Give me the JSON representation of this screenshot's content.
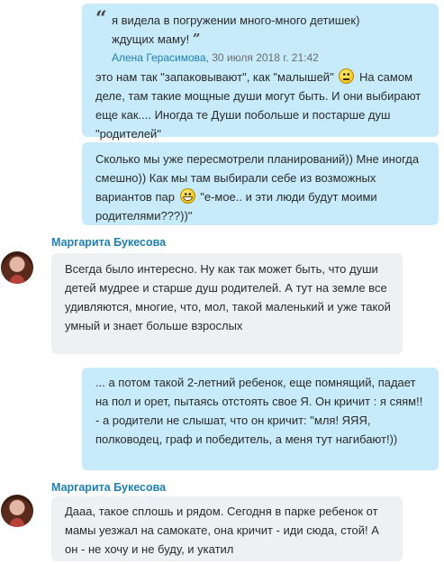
{
  "messages": [
    {
      "quote": {
        "text": "я видела в погружении много-много детишек) ждущих маму!",
        "author": "Алена Герасимова",
        "time": ", 30 июля 2018 г. 21:42"
      },
      "text_before_emoji": "это нам так \"запаковывают\", как \"малышей\"",
      "emoji": "neutral-face-emoji",
      "text_after_emoji": "На самом деле, там такие мощные души могут быть. И они выбирают еще как.... Иногда те Души побольше и постарше душ \"родителей\""
    },
    {
      "text_before_emoji": "Сколько мы уже пересмотрели планирований)) Мне иногда смешно)) Как мы там выбирали себе из возможных вариантов пар",
      "emoji": "grinning-face-emoji",
      "text_after_emoji": "\"е-мое.. и эти люди будут моими родителями???))\""
    },
    {
      "sender": "Маргарита Букесова",
      "text": "Всегда было интересно. Ну как так может быть, что души детей мудрее и старше душ родителей. А тут на земле все удивляются, многие, что, мол, такой маленький и уже такой умный и знает больше взрослых"
    },
    {
      "text": "... а потом такой 2-летний ребенок, еще помнящий, падает на пол и орет, пытаясь отстоять свое Я. Он кричит : я сяям!! - а родители не слышат, что он кричит: \"мля! ЯЯЯ, полководец, граф и победитель,  а меня тут нагибают!))"
    },
    {
      "sender": "Маргарита Букесова",
      "text": "Дааа, такое сплошь и рядом.  Сегодня в парке ребенок от мамы уезжал на самокате, она кричит - иди сюда, стой! А он - не хочу и не буду, и укатил"
    }
  ]
}
